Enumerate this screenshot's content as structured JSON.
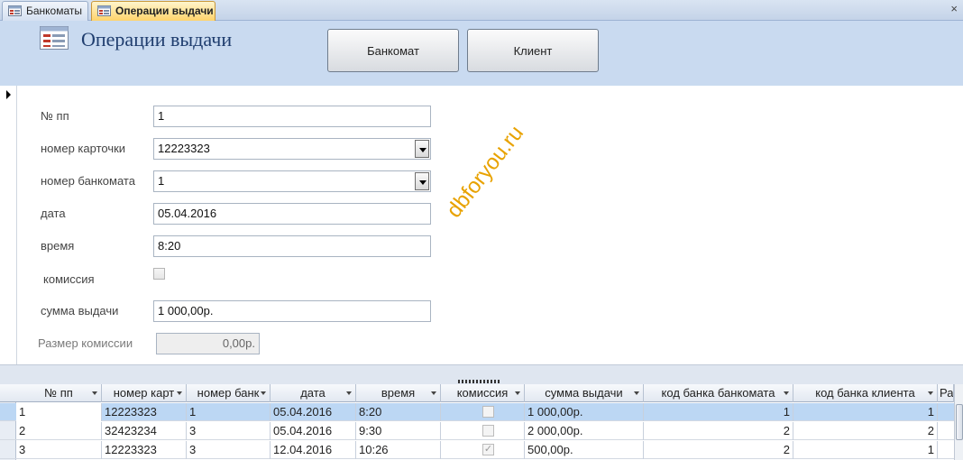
{
  "tabs": [
    {
      "label": "Банкоматы",
      "icon": "form-icon",
      "active": false
    },
    {
      "label": "Операции выдачи",
      "icon": "form-icon",
      "active": true
    }
  ],
  "close_label": "×",
  "header": {
    "title": "Операции выдачи",
    "buttons": {
      "atm": "Банкомат",
      "client": "Клиент"
    }
  },
  "form": {
    "fields": {
      "num": {
        "label": "№ пп",
        "value": "1"
      },
      "card": {
        "label": "номер карточки",
        "value": "12223323"
      },
      "atm": {
        "label": "номер банкомата",
        "value": "1"
      },
      "date": {
        "label": "дата",
        "value": "05.04.2016"
      },
      "time": {
        "label": "время",
        "value": "8:20"
      },
      "commission": {
        "label": "комиссия",
        "checked": false
      },
      "amount": {
        "label": "сумма выдачи",
        "value": "1 000,00р."
      },
      "commission_size": {
        "label": "Размер комиссии",
        "value": "0,00р."
      }
    },
    "watermark": "dbforyou.ru"
  },
  "table": {
    "columns": [
      "№ пп",
      "номер карт",
      "номер банк",
      "дата",
      "время",
      "комиссия",
      "сумма выдачи",
      "код банка банкомата",
      "код банка клиента",
      "Ра"
    ],
    "rows": [
      {
        "num": "1",
        "card": "12223323",
        "atm": "1",
        "date": "05.04.2016",
        "time": "8:20",
        "commission": false,
        "amount": "1 000,00р.",
        "atm_bank": "1",
        "client_bank": "1"
      },
      {
        "num": "2",
        "card": "32423234",
        "atm": "3",
        "date": "05.04.2016",
        "time": "9:30",
        "commission": false,
        "amount": "2 000,00р.",
        "atm_bank": "2",
        "client_bank": "2"
      },
      {
        "num": "3",
        "card": "12223323",
        "atm": "3",
        "date": "12.04.2016",
        "time": "10:26",
        "commission": true,
        "amount": "500,00р.",
        "atm_bank": "2",
        "client_bank": "1"
      }
    ]
  },
  "colors": {
    "header_bg": "#c9daf0",
    "active_tab": "#ffd36b",
    "selected_row": "#bcd7f4",
    "watermark": "#e8a200"
  }
}
